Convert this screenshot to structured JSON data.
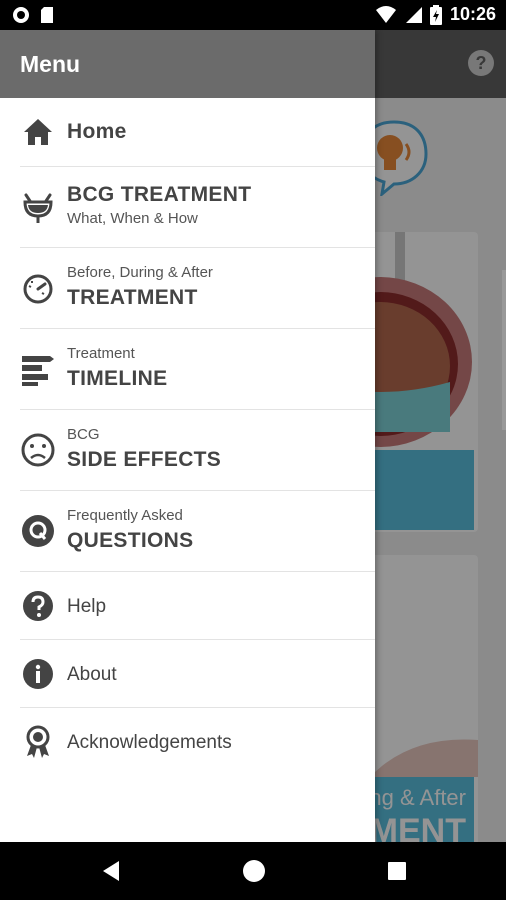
{
  "status_bar": {
    "time": "10:26"
  },
  "app_bar": {
    "help_icon": "help-circle-icon"
  },
  "background": {
    "card2_line1": "ng & After",
    "card2_line2": "MENT"
  },
  "drawer": {
    "title": "Menu",
    "items": [
      {
        "id": "home",
        "icon": "home-icon",
        "label": "Home"
      },
      {
        "id": "bcg-treatment",
        "icon": "bladder-icon",
        "label": "BCG TREATMENT",
        "sublabel": "What, When & How"
      },
      {
        "id": "treatment",
        "icon": "timer-icon",
        "prelabel": "Before, During & After",
        "label": "TREATMENT"
      },
      {
        "id": "timeline",
        "icon": "timeline-icon",
        "prelabel": "Treatment",
        "label": "TIMELINE"
      },
      {
        "id": "side-effects",
        "icon": "sad-face-icon",
        "prelabel": "BCG",
        "label": "SIDE EFFECTS"
      },
      {
        "id": "questions",
        "icon": "q-circle-icon",
        "prelabel": "Frequently Asked",
        "label": "QUESTIONS"
      },
      {
        "id": "help",
        "icon": "help-circle-icon",
        "label": "Help"
      },
      {
        "id": "about",
        "icon": "info-circle-icon",
        "label": "About"
      },
      {
        "id": "acknowledgements",
        "icon": "award-icon",
        "label": "Acknowledgements"
      }
    ]
  },
  "colors": {
    "accent": "#5bbfdf",
    "header": "#6b6b6b",
    "icon": "#444444"
  }
}
